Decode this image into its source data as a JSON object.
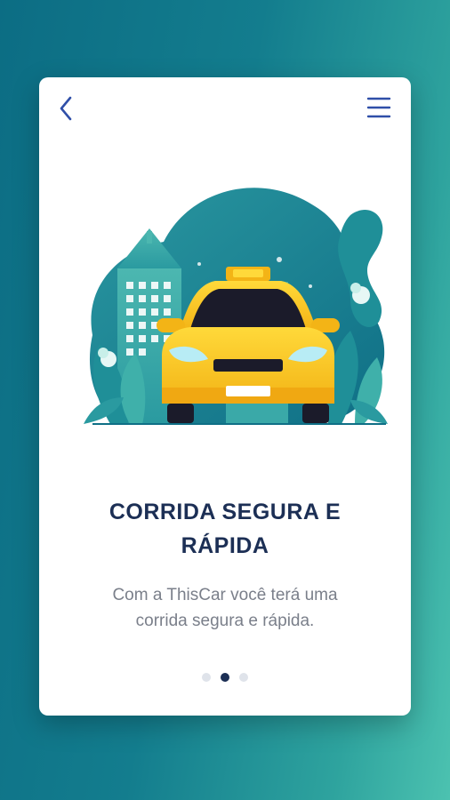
{
  "icons": {
    "back": "chevron-left-icon",
    "menu": "hamburger-menu-icon",
    "pin": "location-pin-icon"
  },
  "onboarding": {
    "title": "CORRIDA SEGURA E\nRÁPIDA",
    "description": "Com a ThisCar você terá uma\ncorrida segura e rápida.",
    "page_indicator": {
      "total": 3,
      "active_index": 1
    }
  },
  "colors": {
    "accent_blue": "#2f4fa8",
    "title_navy": "#1c2f55",
    "taxi_yellow": "#f7c21a",
    "teal": "#1f8f98",
    "pin_red": "#e84b3c"
  }
}
